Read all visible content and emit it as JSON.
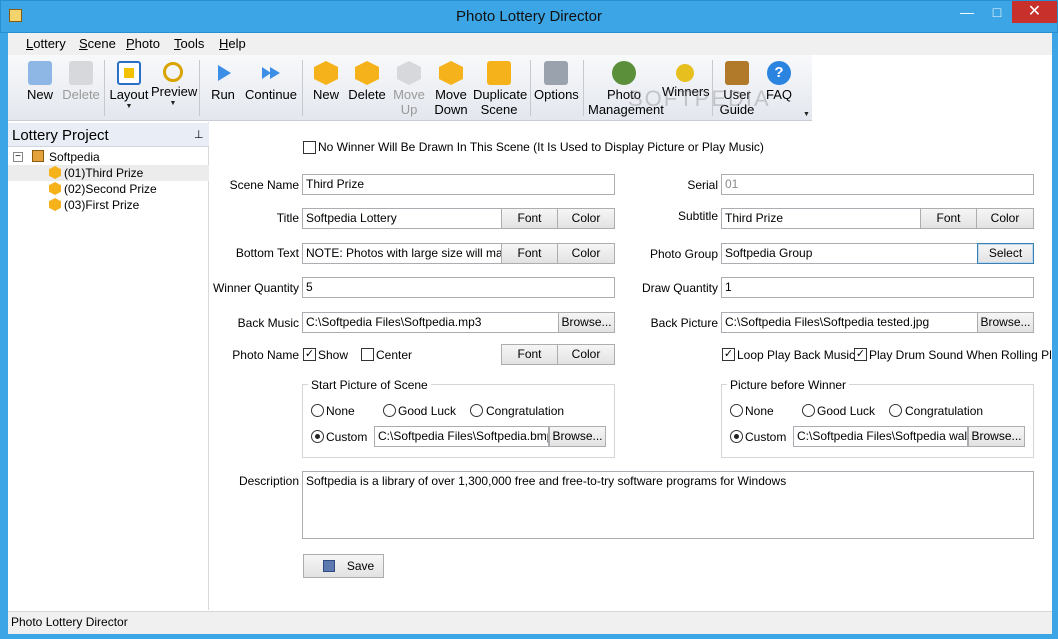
{
  "window": {
    "title": "Photo Lottery Director",
    "min": "—",
    "max": "□",
    "close": "✕"
  },
  "menu": [
    "Lottery",
    "Scene",
    "Photo",
    "Tools",
    "Help"
  ],
  "toolbar": {
    "new_lottery": "New",
    "delete_lottery": "Delete",
    "layout": "Layout",
    "preview": "Preview",
    "run": "Run",
    "continue": "Continue",
    "new_scene": "New",
    "delete_scene": "Delete",
    "move_up": "Move\nUp",
    "move_down": "Move\nDown",
    "duplicate_scene": "Duplicate\nScene",
    "options": "Options",
    "photo_management": "Photo\nManagement",
    "winners": "Winners",
    "user_guide": "User\nGuide",
    "faq": "FAQ"
  },
  "left_panel": {
    "title": "Lottery Project",
    "pin": "⊥",
    "root": "Softpedia",
    "expander": "−",
    "scenes": [
      "(01)Third Prize",
      "(02)Second Prize",
      "(03)First Prize"
    ],
    "selected_index": 0
  },
  "form": {
    "no_winner_checkbox": "No Winner Will Be Drawn In This Scene  (It Is Used to Display Picture or Play Music)",
    "no_winner_checked": false,
    "scene_name_label": "Scene Name",
    "scene_name": "Third Prize",
    "serial_label": "Serial",
    "serial": "01",
    "title_label": "Title",
    "title": "Softpedia Lottery",
    "subtitle_label": "Subtitle",
    "subtitle": "Third Prize",
    "bottom_text_label": "Bottom Text",
    "bottom_text": "NOTE: Photos with large size will make p",
    "photo_group_label": "Photo Group",
    "photo_group": "Softpedia Group",
    "winner_quantity_label": "Winner Quantity",
    "winner_quantity": "5",
    "draw_quantity_label": "Draw Quantity",
    "draw_quantity": "1",
    "back_music_label": "Back Music",
    "back_music": "C:\\Softpedia Files\\Softpedia.mp3",
    "back_picture_label": "Back Picture",
    "back_picture": "C:\\Softpedia Files\\Softpedia tested.jpg",
    "photo_name_label": "Photo Name",
    "show_label": "Show",
    "show_checked": true,
    "center_label": "Center",
    "center_checked": false,
    "loop_music_label": "Loop Play Back Music",
    "loop_music_checked": true,
    "drum_sound_label": "Play Drum Sound When Rolling Photos",
    "drum_sound_checked": true,
    "font_btn": "Font",
    "color_btn": "Color",
    "browse_btn": "Browse...",
    "select_btn": "Select",
    "start_picture": {
      "title": "Start Picture of Scene",
      "options": [
        "None",
        "Good Luck",
        "Congratulation",
        "Custom"
      ],
      "selected": "Custom",
      "custom_path": "C:\\Softpedia Files\\Softpedia.bmp"
    },
    "picture_before_winner": {
      "title": "Picture before Winner",
      "options": [
        "None",
        "Good Luck",
        "Congratulation",
        "Custom"
      ],
      "selected": "Custom",
      "custom_path": "C:\\Softpedia Files\\Softpedia wallpaper.jpg"
    },
    "description_label": "Description",
    "description": "Softpedia is a library of over 1,300,000 free and free-to-try software programs for Windows",
    "save_btn": "Save"
  },
  "status": "Photo Lottery Director",
  "watermark": "SOFTPEDIA"
}
